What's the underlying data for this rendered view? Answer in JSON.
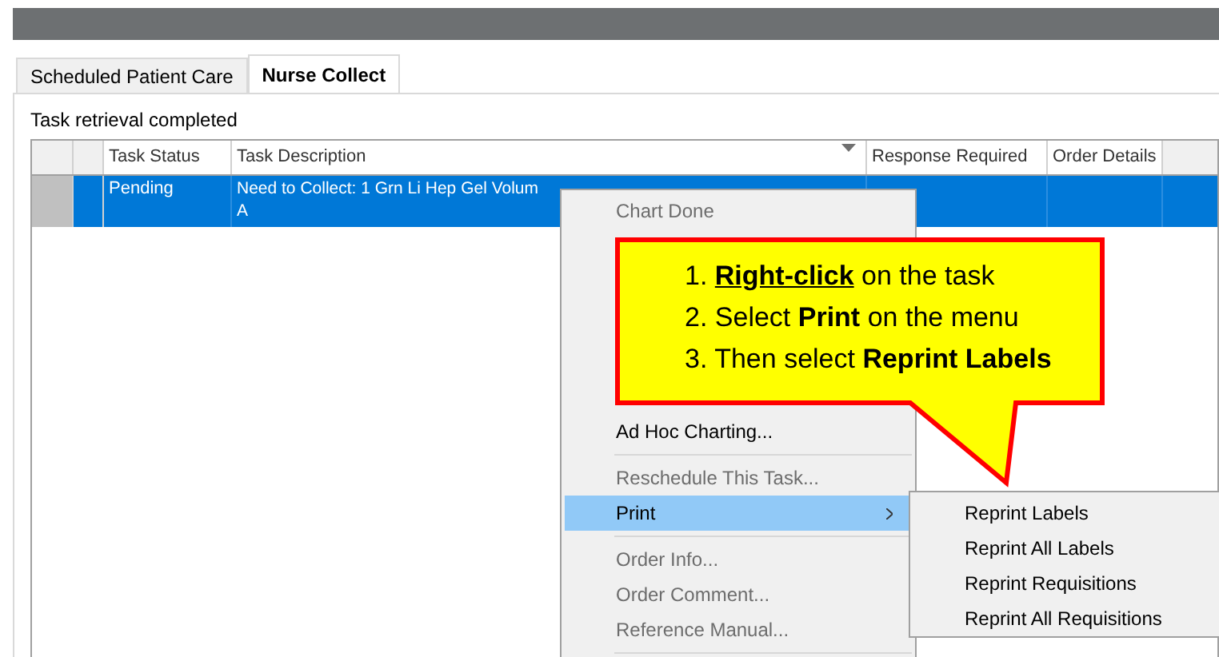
{
  "tabs": [
    {
      "label": "Scheduled Patient Care",
      "selected": false
    },
    {
      "label": "Nurse Collect",
      "selected": true
    }
  ],
  "status_message": "Task retrieval completed",
  "table": {
    "columns": [
      {
        "label": "Task Status",
        "sorted": false
      },
      {
        "label": "Task Description",
        "sorted": true
      },
      {
        "label": "Response Required",
        "sorted": false
      },
      {
        "label": "Order Details",
        "sorted": false
      }
    ],
    "rows": [
      {
        "selected": true,
        "task_status": "Pending",
        "task_description": "Need to Collect: 1 Grn Li Hep Gel Volum\nA"
      }
    ]
  },
  "context_menu": {
    "items": [
      {
        "kind": "item",
        "label": "Chart Done",
        "disabled": true,
        "selected": false,
        "submenu": false
      },
      {
        "kind": "item",
        "label": "Ad Hoc Charting...",
        "disabled": false,
        "selected": false,
        "submenu": false
      },
      {
        "kind": "separator"
      },
      {
        "kind": "item",
        "label": "Reschedule This Task...",
        "disabled": true,
        "selected": false,
        "submenu": false
      },
      {
        "kind": "item",
        "label": "Print",
        "disabled": false,
        "selected": true,
        "submenu": true
      },
      {
        "kind": "separator"
      },
      {
        "kind": "item",
        "label": "Order Info...",
        "disabled": true,
        "selected": false,
        "submenu": false
      },
      {
        "kind": "item",
        "label": "Order Comment...",
        "disabled": true,
        "selected": false,
        "submenu": false
      },
      {
        "kind": "item",
        "label": "Reference Manual...",
        "disabled": true,
        "selected": false,
        "submenu": false
      },
      {
        "kind": "separator"
      }
    ]
  },
  "submenu": {
    "items": [
      {
        "label": "Reprint Labels"
      },
      {
        "label": "Reprint All Labels"
      },
      {
        "label": "Reprint Requisitions"
      },
      {
        "label": "Reprint All Requisitions"
      }
    ]
  },
  "callout": {
    "steps": [
      [
        {
          "text": "1. ",
          "bold": false,
          "underline": false
        },
        {
          "text": "Right-click",
          "bold": true,
          "underline": true
        },
        {
          "text": " on the task",
          "bold": false,
          "underline": false
        }
      ],
      [
        {
          "text": "2. Select ",
          "bold": false,
          "underline": false
        },
        {
          "text": "Print",
          "bold": true,
          "underline": false
        },
        {
          "text": " on the menu",
          "bold": false,
          "underline": false
        }
      ],
      [
        {
          "text": "3. Then select ",
          "bold": false,
          "underline": false
        },
        {
          "text": "Reprint Labels",
          "bold": true,
          "underline": false
        }
      ]
    ]
  }
}
